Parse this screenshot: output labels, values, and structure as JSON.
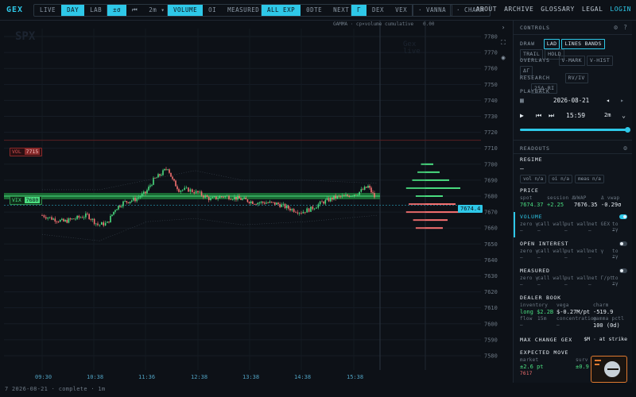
{
  "app": {
    "logo": "GEX"
  },
  "toolbar": {
    "mode_tabs": [
      "LIVE",
      "DAY",
      "LAB"
    ],
    "mode_active": 1,
    "scale_buttons": [
      "±σ",
      "⏮"
    ],
    "interval": "2m",
    "metric_tabs": [
      "VOLUME",
      "OI",
      "MEASURED"
    ],
    "expiry_tabs": [
      "ALL EXP",
      "0DTE",
      "NEXT"
    ],
    "greek_tabs": [
      "Γ",
      "DEX",
      "VEX"
    ],
    "vanna": "VANNA",
    "charm": "CHARM",
    "nav": [
      "ABOUT",
      "ARCHIVE",
      "GLOSSARY",
      "LEGAL",
      "LOGIN"
    ]
  },
  "chart": {
    "watermark_left": "SPX",
    "watermark_right": "Gex\nlive",
    "header_text": "GAMMA · cp×volume cumulative",
    "header_value": "0.00",
    "vol_tag": "VOL",
    "vol_value": "7715",
    "vix_tag": "VIX",
    "vix_value": "7680",
    "price_tag": "7674.4",
    "footer": "7 2026-08-21 · complete · 1m"
  },
  "chart_data": {
    "type": "candlestick",
    "y_ticks": [
      "7780",
      "7770",
      "7760",
      "7750",
      "7740",
      "7730",
      "7720",
      "7710",
      "7700",
      "7690",
      "7680",
      "7670",
      "7660",
      "7650",
      "7640",
      "7630",
      "7620",
      "7610",
      "7600",
      "7590",
      "7580"
    ],
    "x_ticks": [
      "09:30",
      "10:38",
      "11:36",
      "12:38",
      "13:38",
      "14:38",
      "15:38"
    ],
    "ylim": [
      7575,
      7785
    ],
    "last_price": 7674.4,
    "hvl": 7680,
    "gex_bars": [
      {
        "strike": 7700,
        "value": 10,
        "color": "#4ade80"
      },
      {
        "strike": 7695,
        "value": 18,
        "color": "#4ade80"
      },
      {
        "strike": 7690,
        "value": 30,
        "color": "#4ade80"
      },
      {
        "strike": 7685,
        "value": 44,
        "color": "#4ade80"
      },
      {
        "strike": 7680,
        "value": 22,
        "color": "#4ade80"
      },
      {
        "strike": 7675,
        "value": 38,
        "color": "#f87171"
      },
      {
        "strike": 7670,
        "value": 44,
        "color": "#f87171"
      },
      {
        "strike": 7665,
        "value": 28,
        "color": "#f87171"
      },
      {
        "strike": 7660,
        "value": 22,
        "color": "#f87171"
      }
    ]
  },
  "panel": {
    "controls_title": "CONTROLS",
    "draw_label": "DRAW",
    "draw_tabs": [
      "LAD",
      "LINES BANDS",
      "TRAIL",
      "HOLD"
    ],
    "overlays_label": "OVERLAYS",
    "overlay_tabs": [
      "V-MARK",
      "V-HIST",
      "ΔΓ"
    ],
    "research_label": "RESEARCH",
    "research_tabs": [
      "RV/IV",
      "25Δ-RI"
    ],
    "playback_label": "PLAYBACK",
    "date": "2026-08-21",
    "time": "15:59",
    "interval": "2m",
    "playback_progress": 1.0,
    "readouts_title": "READOUTS",
    "regime_label": "REGIME",
    "regime_value": "—",
    "regime_chips": [
      "vol n/a",
      "oi n/a",
      "meas n/a"
    ],
    "price_label": "PRICE",
    "price_cols": [
      "spot",
      "session Δ",
      "VWAP",
      "Δ vwap"
    ],
    "price_vals": [
      "7674.37",
      "+2.25",
      "7676.35",
      "-0.29σ"
    ],
    "volume_label": "VOLUME",
    "volume_cols": [
      "zero γ",
      "call wall",
      "put wall",
      "net GEX",
      "to zγ"
    ],
    "volume_vals": [
      "—",
      "—",
      "—",
      "—",
      "—"
    ],
    "oi_label": "OPEN INTEREST",
    "oi_cols": [
      "zero γ",
      "call wall",
      "put wall",
      "net γ",
      "to zγ"
    ],
    "oi_vals": [
      "—",
      "—",
      "—",
      "—",
      "—"
    ],
    "measured_label": "MEASURED",
    "measured_cols": [
      "zero γ",
      "call wall",
      "put wall",
      "net Γ/pt",
      "to zγ"
    ],
    "measured_vals": [
      "—",
      "—",
      "—",
      "—",
      "—"
    ],
    "dealer_label": "DEALER BOOK",
    "dealer_cols": [
      "inventory",
      "vega",
      "charm"
    ],
    "dealer_vals": [
      "long $2.2B",
      "$-0.27M/pt",
      "-519.9"
    ],
    "dealer_cols2": [
      "flow",
      "15m",
      "concentration",
      "gamma pctl"
    ],
    "dealer_vals2": [
      "—",
      "—",
      "—",
      "100 (0d)"
    ],
    "maxchange_label": "MAX CHANGE GEX",
    "maxchange_value": "$M · at strike",
    "expected_label": "EXPECTED MOVE",
    "expected_cols": [
      "market",
      "",
      "surv"
    ],
    "expected_vals": [
      "±2.6 pt",
      "",
      "±0.9"
    ],
    "expected_price": "7617"
  }
}
